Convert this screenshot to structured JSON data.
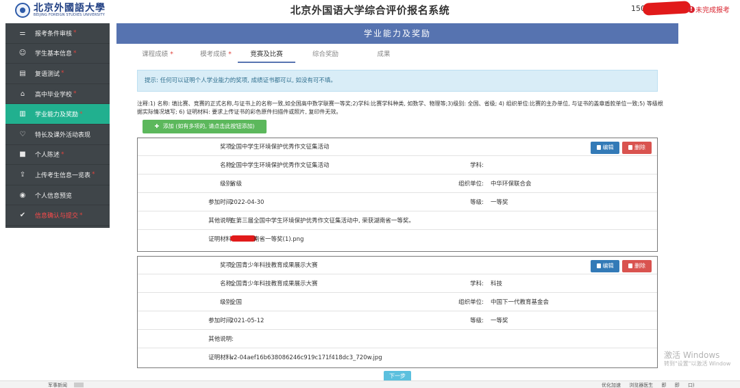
{
  "header": {
    "logo_cn": "北京外國語大學",
    "logo_en": "BEIJING FOREIGN STUDIES UNIVERSITY",
    "title": "北京外国语大学综合评价报名系统",
    "user_id_prefix": "150",
    "status_icon": "alert-icon",
    "status_text": "未完成报考"
  },
  "sidebar": {
    "items": [
      {
        "icon": "sliders-icon",
        "glyph": "⚌",
        "label": "报考条件审核",
        "required": "*"
      },
      {
        "icon": "user-circle-icon",
        "glyph": "☺",
        "label": "学生基本信息",
        "required": "*"
      },
      {
        "icon": "document-icon",
        "glyph": "▤",
        "label": "复语测试",
        "required": "*"
      },
      {
        "icon": "graduation-cap-icon",
        "glyph": "⌂",
        "label": "高中毕业学校",
        "required": "*"
      },
      {
        "icon": "book-icon",
        "glyph": "▥",
        "label": "学业能力及奖励",
        "required": "*",
        "active": true
      },
      {
        "icon": "heart-icon",
        "glyph": "♡",
        "label": "特长及课外活动表现",
        "required": ""
      },
      {
        "icon": "video-icon",
        "glyph": "■",
        "label": "个人陈述",
        "required": "*"
      },
      {
        "icon": "upload-icon",
        "glyph": "⇪",
        "label": "上传考生信息一览表",
        "required": "*"
      },
      {
        "icon": "eye-icon",
        "glyph": "◉",
        "label": "个人信息预览",
        "required": ""
      },
      {
        "icon": "check-circle-icon",
        "glyph": "✔",
        "label": "信息确认与提交",
        "required": "*",
        "warn": true
      }
    ]
  },
  "panel": {
    "title": "学业能力及奖励",
    "tabs": [
      {
        "label": "课程成绩",
        "required": "*"
      },
      {
        "label": "模考成绩",
        "required": "*"
      },
      {
        "label": "竞赛及比赛",
        "required": "",
        "active": true
      },
      {
        "label": "综合奖励",
        "required": ""
      },
      {
        "label": "成果",
        "required": ""
      }
    ],
    "tip": "提示: 任何可以证明个人学业能力的奖项, 成绩证书都可以, 如没有可不填。",
    "notes": "注释:1) 名称: 填比赛、竞赛的正式名称,与证书上的名称一致,如全国高中数学联赛一等奖;2)学科:比赛学科种类, 如数学、物理等;3)级别: 全国、省级; 4) 组织单位:比赛的主办单位, 与证书的盖章盾款单位一致;5) 等级根据实际情况填写; 6) 证明材料: 要求上传证书的彩色原件扫描件或照片, 复印件无效。",
    "add_button": "添加 (如有多项的, 请点击此按钮添加)",
    "edit_label": "编辑",
    "delete_label": "删除",
    "labels": {
      "award": "奖项:",
      "name": "名称:",
      "subject": "学科:",
      "level": "级别:",
      "organizer": "组织单位:",
      "date": "参加时间:",
      "grade": "等级:",
      "other": "其他说明:",
      "proof": "证明材料:"
    },
    "awards": [
      {
        "award": "全国中学生环境保护优秀作文征集活动",
        "name": "全国中学生环境保护优秀作文征集活动",
        "subject": "",
        "level": "省级",
        "organizer": "中华环保联合会",
        "date": "2022-04-30",
        "grade": "一等奖",
        "other": "在第三届全国中学生环境保护优秀作文征集活动中, 荣获湖南省一等奖。",
        "proof": "南省一等奖(1).png"
      },
      {
        "award": "全国青少年科技教育成果展示大赛",
        "name": "全国青少年科技教育成果展示大赛",
        "subject": "科技",
        "level": "全国",
        "organizer": "中国下一代教育基金会",
        "date": "2021-05-12",
        "grade": "一等奖",
        "other": "",
        "proof": "v2-04aef16b638086246c919c171f418dc3_720w.jpg"
      }
    ],
    "next_button": "下一步"
  },
  "watermark": {
    "line1": "激活 Windows",
    "line2": "转到\"设置\"以激活 Window"
  },
  "taskbar": {
    "left_text": "军事新闻",
    "items": [
      "优化加速",
      "浏览器医生",
      "即",
      "即",
      "口)"
    ]
  },
  "colors": {
    "sidebar_bg": "#3f4549",
    "sidebar_active": "#21b08f",
    "title_bar": "#5673b0",
    "edit_button": "#337ab7",
    "delete_button": "#d9534f",
    "add_button": "#5cb85c",
    "next_button": "#5bc0de",
    "status_red": "#d9232e"
  }
}
